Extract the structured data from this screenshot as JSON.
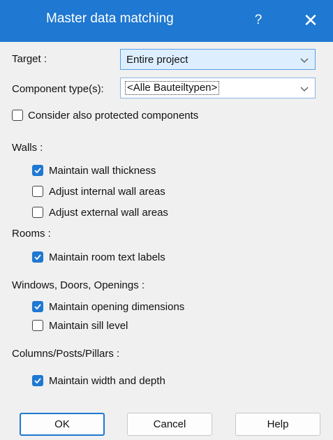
{
  "window": {
    "title": "Master data matching",
    "help_glyph": "?",
    "close_glyph": "✕"
  },
  "target": {
    "label": "Target :",
    "value": "Entire project"
  },
  "component": {
    "label": "Component type(s):",
    "value": "<Alle Bauteiltypen>"
  },
  "protected": {
    "label": "Consider also protected components",
    "checked": false
  },
  "walls": {
    "heading": "Walls :",
    "options": [
      {
        "label": "Maintain wall thickness",
        "checked": true
      },
      {
        "label": "Adjust internal wall areas",
        "checked": false
      },
      {
        "label": "Adjust external wall areas",
        "checked": false
      }
    ]
  },
  "rooms": {
    "heading": "Rooms :",
    "options": [
      {
        "label": "Maintain room text labels",
        "checked": true
      }
    ]
  },
  "openings": {
    "heading": "Windows, Doors, Openings :",
    "options": [
      {
        "label": "Maintain opening dimensions",
        "checked": true
      },
      {
        "label": "Maintain sill level",
        "checked": false
      }
    ]
  },
  "columns": {
    "heading": "Columns/Posts/Pillars :",
    "options": [
      {
        "label": "Maintain width and depth",
        "checked": true
      }
    ]
  },
  "buttons": {
    "ok": "OK",
    "cancel": "Cancel",
    "help": "Help"
  },
  "colors": {
    "accent": "#1f78d1"
  }
}
